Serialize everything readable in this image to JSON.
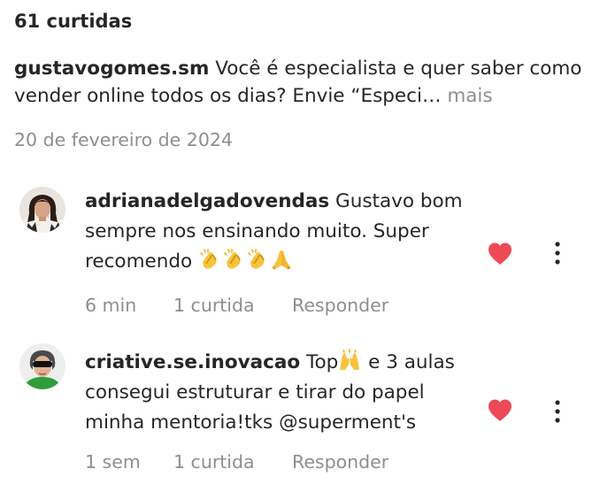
{
  "post": {
    "likes_label": "61 curtidas",
    "caption_user": "gustavogomes.sm",
    "caption_text": "Você é especialista e quer saber como vender online todos os dias? Envie “Especi…",
    "more_label": "mais",
    "date": "20 de fevereiro de 2024"
  },
  "comments": [
    {
      "user": "adrianadelgadovendas",
      "text": "Gustavo bom sempre nos ensinando muito. Super recomendo",
      "emojis": [
        "clapping-hands",
        "clapping-hands",
        "clapping-hands",
        "folded-hands"
      ],
      "time": "6 min",
      "likes": "1 curtida",
      "reply_label": "Responder",
      "liked": true,
      "avatar_icon": "profile-photo-woman-dark-hair"
    },
    {
      "user": "criative.se.inovacao",
      "text_before_emoji": "Top",
      "emoji": "raising-hands",
      "text": "e 3 aulas consegui estruturar e tirar do papel minha mentoria!tks @superment's",
      "time": "1 sem",
      "likes": "1 curtida",
      "reply_label": "Responder",
      "liked": true,
      "avatar_icon": "profile-photo-woman-sunglasses-green"
    }
  ],
  "colors": {
    "heart": "#ed4956",
    "muted": "#8e8e8e",
    "text": "#262626"
  }
}
